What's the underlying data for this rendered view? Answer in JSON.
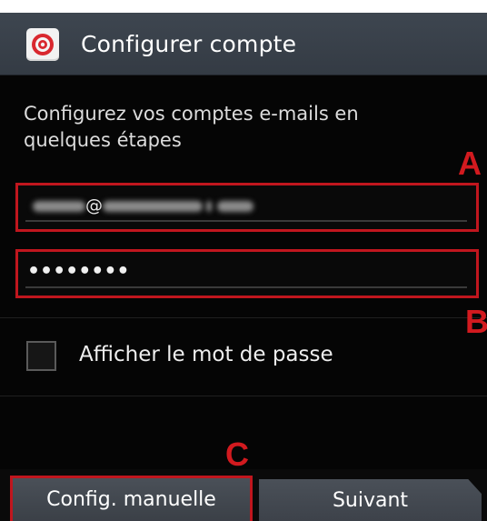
{
  "action_bar": {
    "title": "Configurer compte",
    "icon": "email-app-icon",
    "background_color": "#3a414a"
  },
  "intro": {
    "text": "Configurez vos comptes e-mails en quelques étapes"
  },
  "email_field": {
    "value": "@"
  },
  "password_field": {
    "value": "••••••••"
  },
  "show_password": {
    "label": "Afficher le mot de passe",
    "checked": false
  },
  "buttons": {
    "manual_label": "Config. manuelle",
    "next_label": "Suivant"
  },
  "annotations": {
    "a": "A",
    "b": "B",
    "c": "C",
    "color": "#d21a1f"
  }
}
